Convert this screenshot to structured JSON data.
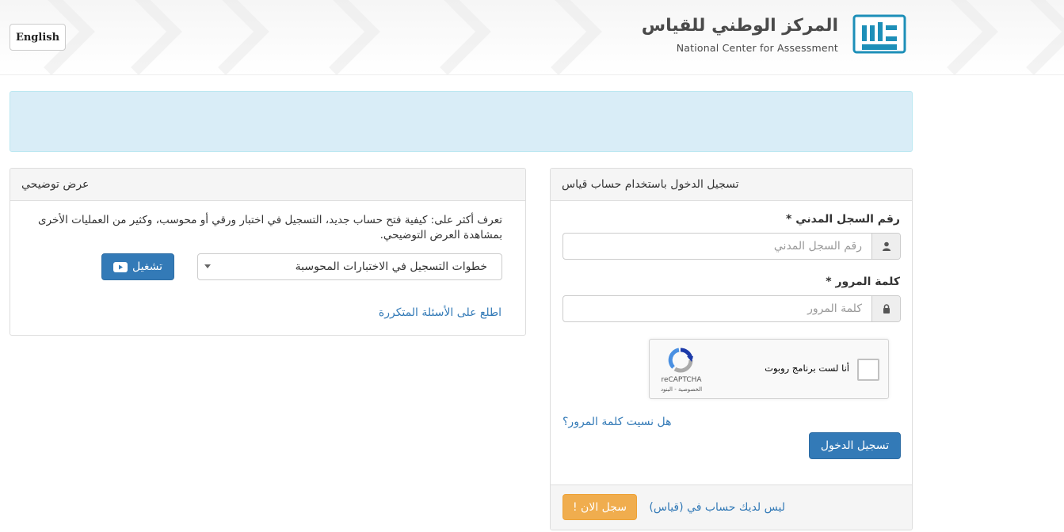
{
  "header": {
    "language_button": "English",
    "logo_title_ar": "المركز الوطني للقياس",
    "logo_title_en": "National Center for Assessment",
    "logo_badge": "QIYAS"
  },
  "login": {
    "heading": "تسجيل الدخول باستخدام حساب قياس",
    "id_label": "رقم السجل المدني *",
    "id_placeholder": "رقم السجل المدني",
    "password_label": "كلمة المرور *",
    "password_placeholder": "كلمة المرور",
    "captcha_label": "أنا لست برنامج روبوت",
    "captcha_brand": "reCAPTCHA",
    "captcha_links": "الخصوصية - البنود",
    "forgot_password": "هل نسيت كلمة المرور؟",
    "login_button": "تسجيل الدخول",
    "no_account_text": "ليس لديك حساب في (قياس)",
    "register_button": "سجل الان !"
  },
  "demo": {
    "heading": "عرض توضيحي",
    "description": "تعرف أكثر على: كيفية فتح حساب جديد، التسجيل في اختبار ورقي أو محوسب، وكثير من العمليات الأخرى بمشاهدة العرض التوضيحي.",
    "selected_option": "خطوات التسجيل في الاختبارات المحوسبة",
    "play_button": "تشغيل",
    "faq_link": "اطلع على الأسئلة المتكررة"
  },
  "colors": {
    "primary": "#337ab7",
    "warning": "#f0ad4e",
    "alert_bg": "#d9edf7",
    "panel_heading": "#f5f5f5"
  }
}
